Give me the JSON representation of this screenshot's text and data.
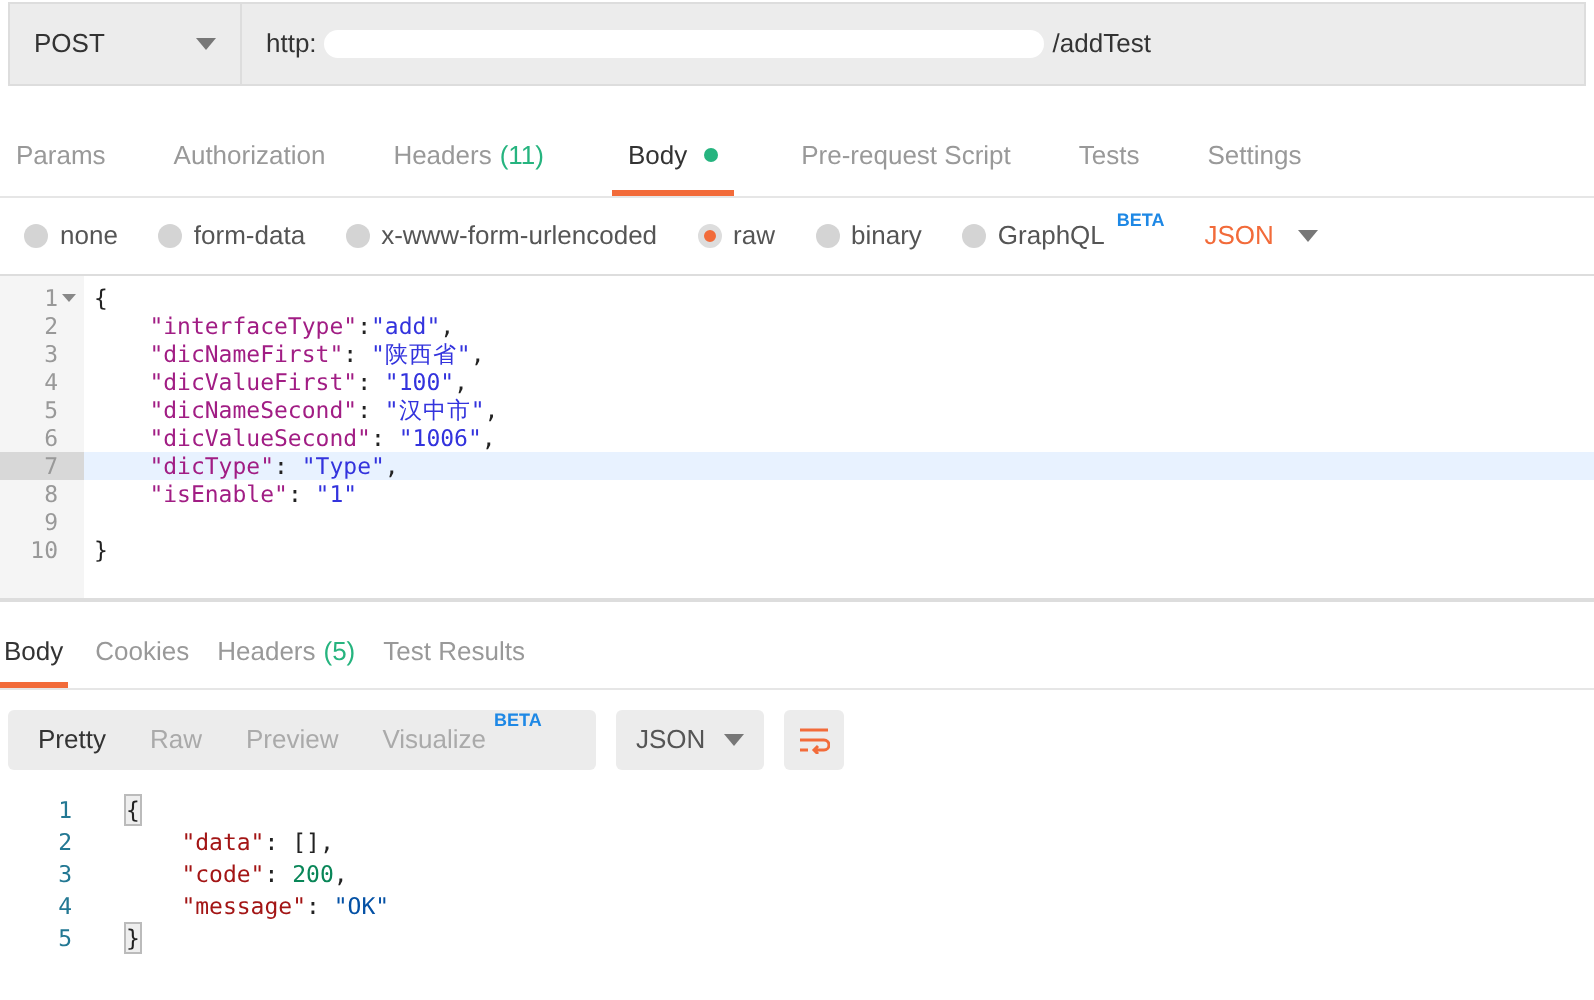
{
  "request": {
    "method": "POST",
    "url_start": "http:",
    "url_end": "/addTest"
  },
  "request_tabs": [
    {
      "label": "Params",
      "selected": false
    },
    {
      "label": "Authorization",
      "selected": false
    },
    {
      "label": "Headers",
      "count": "(11)",
      "selected": false
    },
    {
      "label": "Body",
      "dot": true,
      "selected": true
    },
    {
      "label": "Pre-request Script",
      "selected": false
    },
    {
      "label": "Tests",
      "selected": false
    },
    {
      "label": "Settings",
      "selected": false
    }
  ],
  "body_types": [
    {
      "label": "none",
      "selected": false
    },
    {
      "label": "form-data",
      "selected": false
    },
    {
      "label": "x-www-form-urlencoded",
      "selected": false
    },
    {
      "label": "raw",
      "selected": true
    },
    {
      "label": "binary",
      "selected": false
    },
    {
      "label": "GraphQL",
      "badge": "BETA",
      "selected": false
    }
  ],
  "body_format": "JSON",
  "request_body": [
    {
      "number": "1",
      "foldable": true,
      "selected": false,
      "tokens": [
        {
          "kind": "punct",
          "text": "{"
        }
      ]
    },
    {
      "number": "2",
      "foldable": false,
      "selected": false,
      "tokens": [
        {
          "kind": "key",
          "text": "    \"interfaceType\""
        },
        {
          "kind": "punct",
          "text": ":"
        },
        {
          "kind": "string",
          "text": "\"add\""
        },
        {
          "kind": "punct",
          "text": ","
        }
      ]
    },
    {
      "number": "3",
      "foldable": false,
      "selected": false,
      "tokens": [
        {
          "kind": "key",
          "text": "    \"dicNameFirst\""
        },
        {
          "kind": "punct",
          "text": ": "
        },
        {
          "kind": "string",
          "text": "\"陕西省\""
        },
        {
          "kind": "punct",
          "text": ","
        }
      ]
    },
    {
      "number": "4",
      "foldable": false,
      "selected": false,
      "tokens": [
        {
          "kind": "key",
          "text": "    \"dicValueFirst\""
        },
        {
          "kind": "punct",
          "text": ": "
        },
        {
          "kind": "string",
          "text": "\"100\""
        },
        {
          "kind": "punct",
          "text": ","
        }
      ]
    },
    {
      "number": "5",
      "foldable": false,
      "selected": false,
      "tokens": [
        {
          "kind": "key",
          "text": "    \"dicNameSecond\""
        },
        {
          "kind": "punct",
          "text": ": "
        },
        {
          "kind": "string",
          "text": "\"汉中市\""
        },
        {
          "kind": "punct",
          "text": ","
        }
      ]
    },
    {
      "number": "6",
      "foldable": false,
      "selected": false,
      "tokens": [
        {
          "kind": "key",
          "text": "    \"dicValueSecond\""
        },
        {
          "kind": "punct",
          "text": ": "
        },
        {
          "kind": "string",
          "text": "\"1006\""
        },
        {
          "kind": "punct",
          "text": ","
        }
      ]
    },
    {
      "number": "7",
      "foldable": false,
      "selected": true,
      "tokens": [
        {
          "kind": "key",
          "text": "    \"dicType\""
        },
        {
          "kind": "punct",
          "text": ": "
        },
        {
          "kind": "string",
          "text": "\"Type\""
        },
        {
          "kind": "punct",
          "text": ","
        }
      ]
    },
    {
      "number": "8",
      "foldable": false,
      "selected": false,
      "tokens": [
        {
          "kind": "key",
          "text": "    \"isEnable\""
        },
        {
          "kind": "punct",
          "text": ": "
        },
        {
          "kind": "string",
          "text": "\"1\""
        }
      ]
    },
    {
      "number": "9",
      "foldable": false,
      "selected": false
    },
    {
      "number": "10",
      "foldable": false,
      "selected": false,
      "tokens": [
        {
          "kind": "punct",
          "text": "}"
        }
      ]
    }
  ],
  "response_tabs": [
    {
      "label": "Body",
      "selected": true
    },
    {
      "label": "Cookies",
      "selected": false
    },
    {
      "label": "Headers",
      "count": "(5)",
      "selected": false
    },
    {
      "label": "Test Results",
      "selected": false
    }
  ],
  "view_modes": [
    {
      "label": "Pretty",
      "selected": true
    },
    {
      "label": "Raw",
      "selected": false
    },
    {
      "label": "Preview",
      "selected": false
    },
    {
      "label": "Visualize",
      "badge": "BETA",
      "selected": false
    }
  ],
  "response_format": "JSON",
  "response_body": [
    {
      "number": "1",
      "tokens": [
        {
          "kind": "brace",
          "text": "{"
        }
      ]
    },
    {
      "number": "2",
      "tokens": [
        {
          "kind": "key",
          "text": "    \"data\""
        },
        {
          "kind": "punct",
          "text": ": [],"
        }
      ]
    },
    {
      "number": "3",
      "tokens": [
        {
          "kind": "key",
          "text": "    \"code\""
        },
        {
          "kind": "punct",
          "text": ": "
        },
        {
          "kind": "number",
          "text": "200"
        },
        {
          "kind": "punct",
          "text": ","
        }
      ]
    },
    {
      "number": "4",
      "tokens": [
        {
          "kind": "key",
          "text": "    \"message\""
        },
        {
          "kind": "punct",
          "text": ": "
        },
        {
          "kind": "string",
          "text": "\"OK\""
        }
      ]
    },
    {
      "number": "5",
      "tokens": [
        {
          "kind": "brace",
          "text": "}"
        }
      ]
    }
  ]
}
